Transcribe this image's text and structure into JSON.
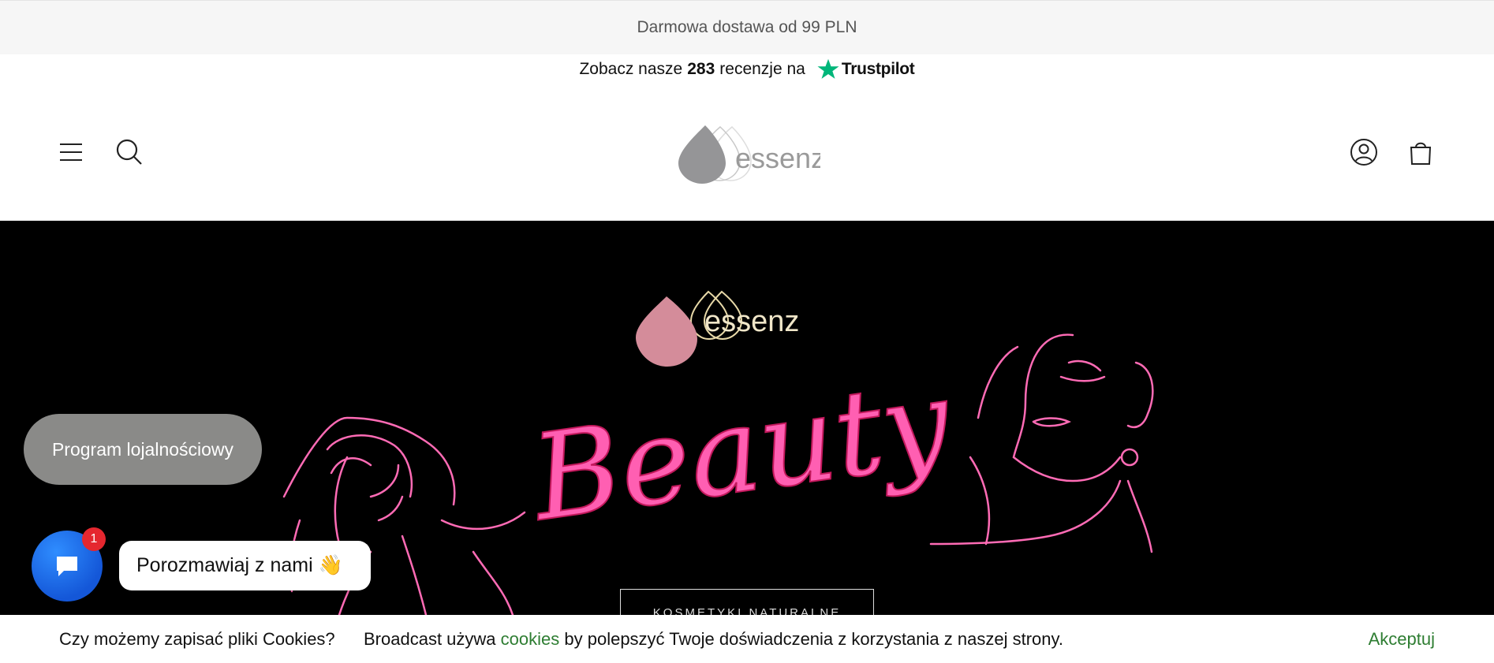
{
  "announcement": {
    "text": "Darmowa dostawa od 99 PLN"
  },
  "trustpilot": {
    "prefix": "Zobacz nasze",
    "count": "283",
    "suffix": "recenzje na",
    "brand": "Trustpilot",
    "star_color": "#00b67a"
  },
  "header": {
    "icons": [
      "menu-icon",
      "search-icon",
      "account-icon",
      "cart-icon"
    ],
    "logo_text": "essenz"
  },
  "hero": {
    "logo_text": "essenz",
    "script_title": "Beauty",
    "button_label": "KOSMETYKI NATURALNE",
    "accent_color": "#ff5fb2"
  },
  "loyalty": {
    "label": "Program lojalnościowy"
  },
  "chat": {
    "badge": "1",
    "bubble_text": "Porozmawiaj z nami 👋",
    "fab_color": "#1f6fee"
  },
  "cookie_bar": {
    "question": "Czy możemy zapisać pliki Cookies?",
    "message_before": "Broadcast używa",
    "link_text": "cookies",
    "message_after": "by polepszyć Twoje doświadczenia z korzystania z naszej strony.",
    "accept_label": "Akceptuj",
    "accent_color": "#2e7d32"
  }
}
